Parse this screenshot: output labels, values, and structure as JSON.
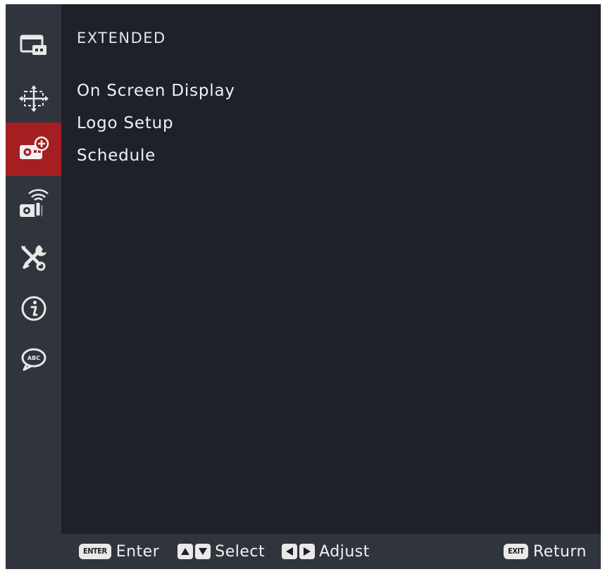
{
  "section": {
    "title": "EXTENDED"
  },
  "sidebar": {
    "items": [
      {
        "icon": "display-icon",
        "active": false
      },
      {
        "icon": "image-adjust-icon",
        "active": false
      },
      {
        "icon": "extended-projector-icon",
        "active": true
      },
      {
        "icon": "network-projector-icon",
        "active": false
      },
      {
        "icon": "tools-icon",
        "active": false
      },
      {
        "icon": "info-icon",
        "active": false
      },
      {
        "icon": "language-icon",
        "active": false
      }
    ]
  },
  "menu": {
    "items": [
      {
        "label": "On Screen Display"
      },
      {
        "label": "Logo Setup"
      },
      {
        "label": "Schedule"
      }
    ]
  },
  "footer": {
    "enter_key": "ENTER",
    "enter_label": "Enter",
    "select_label": "Select",
    "adjust_label": "Adjust",
    "exit_key": "EXIT",
    "return_label": "Return"
  },
  "colors": {
    "background": "#1e2129",
    "sidebar": "#30343d",
    "active_highlight": "#a51e22",
    "text": "#f1f1f1"
  }
}
